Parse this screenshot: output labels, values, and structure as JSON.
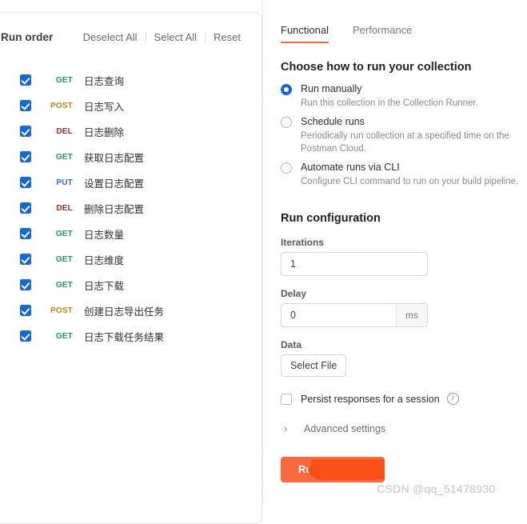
{
  "left_panel": {
    "title": "Run order",
    "actions": [
      {
        "label": "Deselect All"
      },
      {
        "label": "Select All"
      },
      {
        "label": "Reset"
      }
    ],
    "requests": [
      {
        "method": "GET",
        "name": "日志查询",
        "checked": true
      },
      {
        "method": "POST",
        "name": "日志写入",
        "checked": true
      },
      {
        "method": "DEL",
        "name": "日志删除",
        "checked": true
      },
      {
        "method": "GET",
        "name": "获取日志配置",
        "checked": true
      },
      {
        "method": "PUT",
        "name": "设置日志配置",
        "checked": true
      },
      {
        "method": "DEL",
        "name": "删除日志配置",
        "checked": true
      },
      {
        "method": "GET",
        "name": "日志数量",
        "checked": true
      },
      {
        "method": "GET",
        "name": "日志维度",
        "checked": true
      },
      {
        "method": "GET",
        "name": "日志下载",
        "checked": true
      },
      {
        "method": "POST",
        "name": "创建日志导出任务",
        "checked": true
      },
      {
        "method": "GET",
        "name": "日志下载任务结果",
        "checked": true
      }
    ]
  },
  "right_panel": {
    "tabs": [
      {
        "label": "Functional",
        "active": true
      },
      {
        "label": "Performance",
        "active": false
      }
    ],
    "choose_title": "Choose how to run your collection",
    "run_modes": [
      {
        "label": "Run manually",
        "desc": "Run this collection in the Collection Runner.",
        "selected": true
      },
      {
        "label": "Schedule runs",
        "desc": "Periodically run collection at a specified time on the Postman Cloud.",
        "selected": false
      },
      {
        "label": "Automate runs via CLI",
        "desc": "Configure CLI command to run on your build pipeline.",
        "selected": false
      }
    ],
    "run_configuration_title": "Run configuration",
    "iterations": {
      "label": "Iterations",
      "value": "1"
    },
    "delay": {
      "label": "Delay",
      "value": "0",
      "unit": "ms"
    },
    "data": {
      "label": "Data",
      "select_file_label": "Select File"
    },
    "persist": {
      "label": "Persist responses for a session",
      "checked": false,
      "info": "i"
    },
    "advanced": {
      "label": "Advanced settings",
      "chevron": "›"
    },
    "run_button": {
      "label": "Run"
    }
  },
  "watermark": "CSDN @qq_51478930",
  "colors": {
    "accent_orange": "#f26b3a",
    "button_orange": "#f9693f",
    "redaction_red": "#fb4f18",
    "checkbox_blue": "#1368d4",
    "method_get": "#1d9e5e",
    "method_post": "#c7811d",
    "method_del": "#9b2c2c",
    "method_put": "#2d6cc7"
  }
}
